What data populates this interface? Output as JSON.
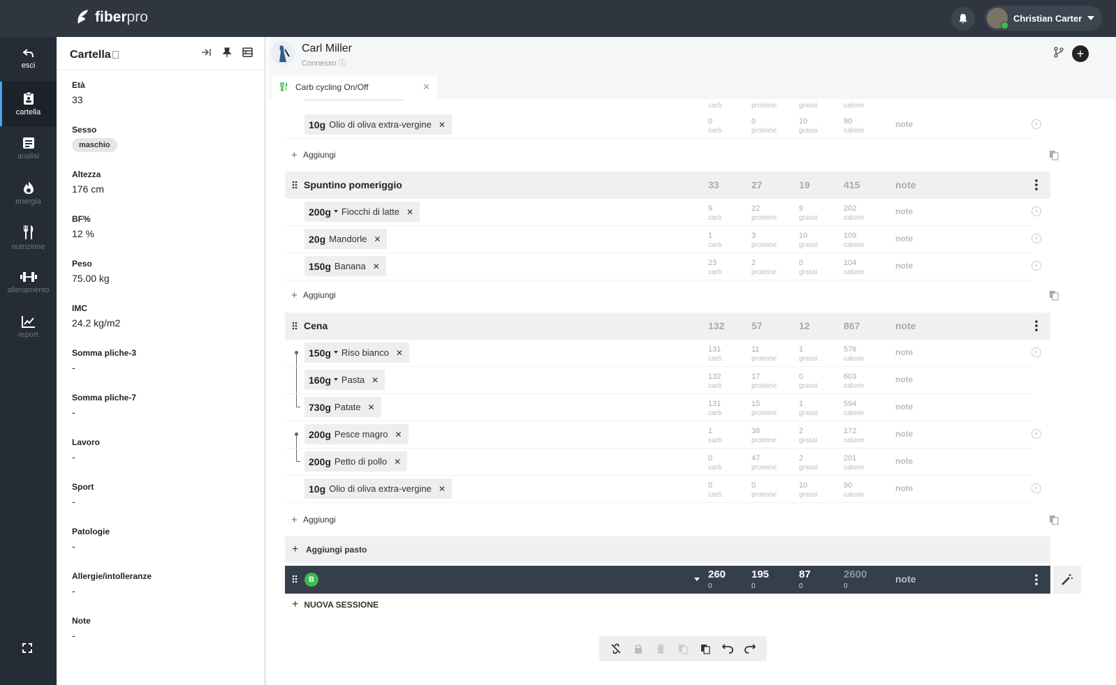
{
  "app": {
    "brand_bold": "fiber",
    "brand_light": "pro"
  },
  "user": {
    "name": "Christian Carter"
  },
  "nav": [
    {
      "label": "esci",
      "icon": "back-arrow-icon"
    },
    {
      "label": "cartella",
      "icon": "clipboard-icon"
    },
    {
      "label": "analisi",
      "icon": "document-icon"
    },
    {
      "label": "energia",
      "icon": "flame-icon"
    },
    {
      "label": "nutrizione",
      "icon": "fork-knife-icon"
    },
    {
      "label": "allenamento",
      "icon": "dumbbell-icon"
    },
    {
      "label": "report",
      "icon": "chart-icon"
    }
  ],
  "panel": {
    "title": "Cartella",
    "fields": [
      {
        "label": "Età",
        "value": "33"
      },
      {
        "label": "Sesso",
        "value": "maschio"
      },
      {
        "label": "Altezza",
        "value": "176 cm"
      },
      {
        "label": "BF%",
        "value": "12 %"
      },
      {
        "label": "Peso",
        "value": "75.00 kg"
      },
      {
        "label": "IMC",
        "value": "24.2 kg/m2"
      },
      {
        "label": "Somma pliche-3",
        "value": "-"
      },
      {
        "label": "Somma pliche-7",
        "value": "-"
      },
      {
        "label": "Lavoro",
        "value": "-"
      },
      {
        "label": "Sport",
        "value": "-"
      },
      {
        "label": "Patologie",
        "value": "-"
      },
      {
        "label": "Allergie/intolleranze",
        "value": "-"
      },
      {
        "label": "Note",
        "value": "-"
      }
    ]
  },
  "client": {
    "name": "Carl Miller",
    "status": "Connesso"
  },
  "tab": {
    "label": "Carb cycling On/Off"
  },
  "units": {
    "carb": "carb",
    "protein": "proteine",
    "fat": "grassi",
    "cal": "calorie"
  },
  "labels": {
    "note": "note",
    "add": "Aggiungi",
    "add_meal": "Aggiungi pasto",
    "new_session": "NUOVA SESSIONE"
  },
  "top_partial_food": {
    "qty": "10g",
    "name": "Olio di oliva extra-vergine",
    "carb": "0",
    "protein": "0",
    "fat": "10",
    "cal": "90"
  },
  "meals": [
    {
      "name": "Spuntino pomeriggio",
      "totals": {
        "carb": "33",
        "protein": "27",
        "fat": "19",
        "cal": "415"
      },
      "foods": [
        {
          "qty": "200g",
          "name": "Fiocchi di latte",
          "dropdown": true,
          "carb": "9",
          "protein": "22",
          "fat": "9",
          "cal": "202"
        },
        {
          "qty": "20g",
          "name": "Mandorle",
          "dropdown": false,
          "carb": "1",
          "protein": "3",
          "fat": "10",
          "cal": "109"
        },
        {
          "qty": "150g",
          "name": "Banana",
          "dropdown": false,
          "carb": "23",
          "protein": "2",
          "fat": "0",
          "cal": "104"
        }
      ]
    },
    {
      "name": "Cena",
      "totals": {
        "carb": "132",
        "protein": "57",
        "fat": "12",
        "cal": "867"
      },
      "foods": [
        {
          "qty": "150g",
          "name": "Riso bianco",
          "dropdown": true,
          "carb": "131",
          "protein": "11",
          "fat": "1",
          "cal": "576"
        },
        {
          "qty": "160g",
          "name": "Pasta",
          "dropdown": true,
          "carb": "132",
          "protein": "17",
          "fat": "0",
          "cal": "603"
        },
        {
          "qty": "730g",
          "name": "Patate",
          "dropdown": false,
          "carb": "131",
          "protein": "15",
          "fat": "1",
          "cal": "594"
        },
        {
          "qty": "200g",
          "name": "Pesce magro",
          "dropdown": false,
          "carb": "1",
          "protein": "38",
          "fat": "2",
          "cal": "172"
        },
        {
          "qty": "200g",
          "name": "Petto di pollo",
          "dropdown": false,
          "carb": "0",
          "protein": "47",
          "fat": "2",
          "cal": "201"
        },
        {
          "qty": "10g",
          "name": "Olio di oliva extra-vergine",
          "dropdown": false,
          "carb": "0",
          "protein": "0",
          "fat": "10",
          "cal": "90"
        }
      ]
    }
  ],
  "session": {
    "badge": "B",
    "carb": "260",
    "protein": "195",
    "fat": "87",
    "cal": "2600",
    "carb_sub": "0",
    "protein_sub": "0",
    "fat_sub": "0",
    "cal_sub": "0"
  }
}
